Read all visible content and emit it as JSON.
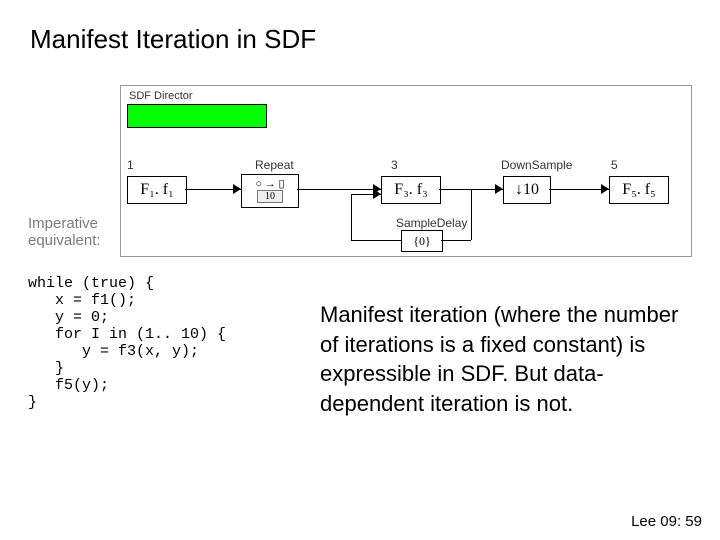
{
  "title": "Manifest Iteration in SDF",
  "diagram": {
    "director_label": "SDF Director",
    "labels": {
      "n1": "1",
      "repeat": "Repeat",
      "n3": "3",
      "down": "DownSample",
      "n5": "5",
      "sdelay": "SampleDelay"
    },
    "blocks": {
      "f1": "F₁. f₁",
      "repeat_icon": "○ → ▯",
      "repeat_badge": "10",
      "f3": "F₃. f₃",
      "down": "↓10",
      "f5": "F₅. f₅",
      "sdelay": "{0}"
    }
  },
  "imperative_label": "Imperative\nequivalent:",
  "code": "while (true) {\n   x = f1();\n   y = 0;\n   for I in (1.. 10) {\n      y = f3(x, y);\n   }\n   f5(y);\n}",
  "body": "Manifest iteration (where the number of iterations is a fixed constant) is expressible in SDF. But data-dependent iteration is not.",
  "footer": "Lee 09: 59"
}
